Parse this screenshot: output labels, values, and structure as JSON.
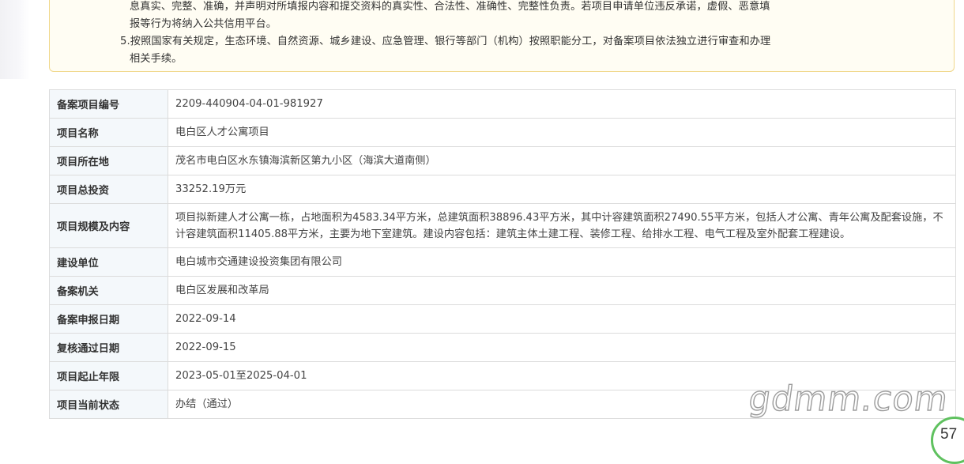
{
  "notice": {
    "line1": "息真实、完整、准确，并声明对所填报内容和提交资料的真实性、合法性、准确性、完整性负责。若项目申请单位违反承诺，虚假、恶意填",
    "line2": "报等行为将纳入公共信用平台。",
    "line3": "5.按照国家有关规定，生态环境、自然资源、城乡建设、应急管理、银行等部门（机构）按照职能分工，对备案项目依法独立进行审查和办理",
    "line4": "相关手续。"
  },
  "rows": [
    {
      "label": "备案项目编号",
      "value": "2209-440904-04-01-981927"
    },
    {
      "label": "项目名称",
      "value": "电白区人才公寓项目"
    },
    {
      "label": "项目所在地",
      "value": "茂名市电白区水东镇海滨新区第九小区（海滨大道南侧）"
    },
    {
      "label": "项目总投资",
      "value": "33252.19万元"
    },
    {
      "label": "项目规模及内容",
      "value": "项目拟新建人才公寓一栋，占地面积为4583.34平方米，总建筑面积38896.43平方米，其中计容建筑面积27490.55平方米，包括人才公寓、青年公寓及配套设施，不计容建筑面积11405.88平方米，主要为地下室建筑。建设内容包括：建筑主体土建工程、装修工程、给排水工程、电气工程及室外配套工程建设。"
    },
    {
      "label": "建设单位",
      "value": "电白城市交通建设投资集团有限公司"
    },
    {
      "label": "备案机关",
      "value": "电白区发展和改革局"
    },
    {
      "label": "备案申报日期",
      "value": "2022-09-14"
    },
    {
      "label": "复核通过日期",
      "value": "2022-09-15"
    },
    {
      "label": "项目起止年限",
      "value": "2023-05-01至2025-04-01"
    },
    {
      "label": "项目当前状态",
      "value": "办结（通过）"
    }
  ],
  "watermark": "gdmm.com",
  "badge": {
    "text": "57",
    "color": "#5fc15f"
  }
}
